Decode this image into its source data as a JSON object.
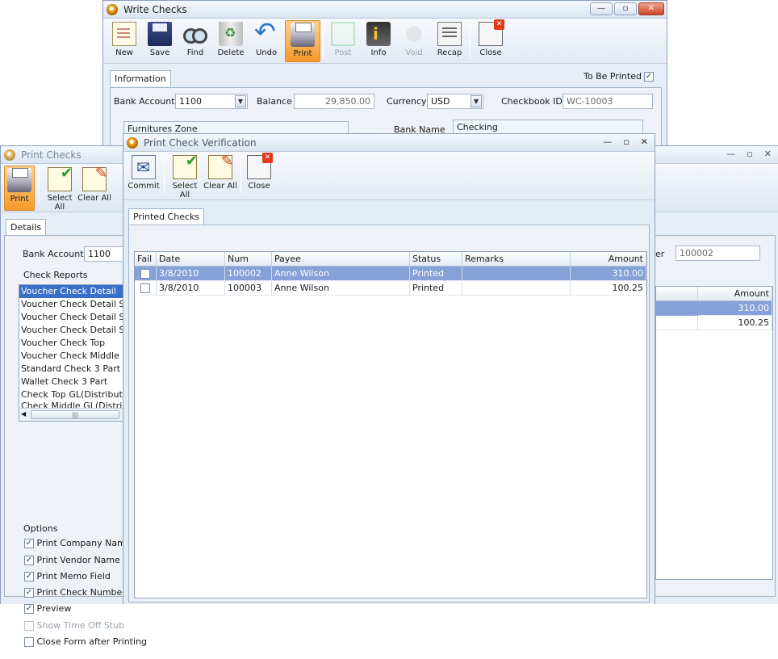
{
  "write_checks": {
    "title": "Write Checks",
    "toolbar": {
      "new": "New",
      "save": "Save",
      "find": "Find",
      "delete": "Delete",
      "undo": "Undo",
      "print": "Print",
      "post": "Post",
      "info": "Info",
      "void": "Void",
      "recap": "Recap",
      "close": "Close"
    },
    "tab_information": "Information",
    "to_be_printed_label": "To Be Printed",
    "to_be_printed_mark": "✓",
    "bank_account_label": "Bank Account",
    "bank_account_value": "1100",
    "balance_label": "Balance",
    "balance_value": "29,850.00",
    "currency_label": "Currency",
    "currency_value": "USD",
    "checkbook_id_label": "Checkbook ID",
    "checkbook_id_value": "WC-10003",
    "payee_value": "Furnitures Zone",
    "bank_name_label": "Bank Name",
    "bank_name_value": "Checking"
  },
  "print_checks": {
    "title": "Print Checks",
    "toolbar": {
      "print": "Print",
      "select_all": "Select All",
      "clear_all": "Clear All"
    },
    "tab_details": "Details",
    "bank_account_label": "Bank Account",
    "bank_account_value": "1100",
    "number_label_fragment": "er",
    "number_value": "100002",
    "check_reports_title": "Check Reports",
    "reports": [
      "Voucher Check Detail",
      "Voucher Check Detail Split",
      "Voucher Check Detail Split",
      "Voucher Check Detail Split",
      "Voucher Check Top",
      "Voucher Check Middle",
      "Standard Check 3 Part",
      "Wallet Check 3 Part",
      "Check Top GL(Distributed)",
      "Check Middle GL(Distributed)"
    ],
    "options_title": "Options",
    "options": [
      {
        "label": "Print Company Name",
        "mark": "✓"
      },
      {
        "label": "Print Vendor Name",
        "mark": "✓"
      },
      {
        "label": "Print Memo Field",
        "mark": "✓"
      },
      {
        "label": "Print Check Number",
        "mark": "✓"
      },
      {
        "label": "Preview",
        "mark": "✓"
      },
      {
        "label": "Show Time Off Stub",
        "mark": ""
      },
      {
        "label": "Close Form after Printing",
        "mark": ""
      }
    ],
    "amount_header": "Amount",
    "amounts": [
      "310.00",
      "100.25"
    ]
  },
  "verification": {
    "title": "Print Check Verification",
    "toolbar": {
      "commit": "Commit",
      "select_all": "Select All",
      "clear_all": "Clear All",
      "close": "Close"
    },
    "tab_printed_checks": "Printed Checks",
    "columns": [
      "Fail",
      "Date",
      "Num",
      "Payee",
      "Status",
      "Remarks",
      "Amount"
    ],
    "rows": [
      {
        "date": "3/8/2010",
        "num": "100002",
        "payee": "Anne Wilson",
        "status": "Printed",
        "remarks": "",
        "amount": "310.00"
      },
      {
        "date": "3/8/2010",
        "num": "100003",
        "payee": "Anne Wilson",
        "status": "Printed",
        "remarks": "",
        "amount": "100.25"
      }
    ]
  },
  "window_controls": {
    "minimize": "—",
    "restore": "▫",
    "close": "✕"
  }
}
